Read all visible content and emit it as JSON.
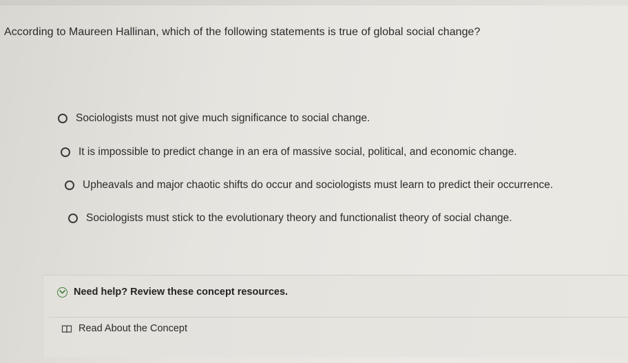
{
  "question": {
    "text": "According to Maureen Hallinan, which of the following statements is true of global social change?"
  },
  "options": [
    {
      "label": "Sociologists must not give much significance to social change."
    },
    {
      "label": "It is impossible to predict change in an era of massive social, political, and economic change."
    },
    {
      "label": "Upheavals and major chaotic shifts do occur and sociologists must learn to predict their occurrence."
    },
    {
      "label": "Sociologists must stick to the evolutionary theory and functionalist theory of social change."
    }
  ],
  "help": {
    "title": "Need help? Review these concept resources.",
    "icon": "chevron-down-icon",
    "resource": {
      "label": "Read About the Concept",
      "icon": "book-icon"
    }
  },
  "colors": {
    "text": "#2b2b2b",
    "accent_green": "#3f7f3a"
  }
}
